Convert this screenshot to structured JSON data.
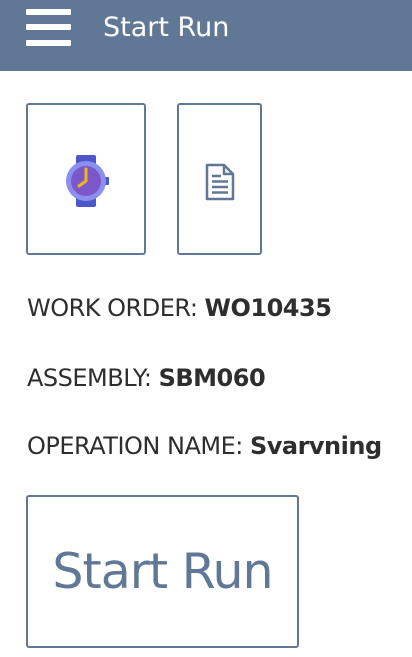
{
  "header": {
    "title": "Start Run",
    "menu_icon": "hamburger-menu-icon"
  },
  "tiles": [
    {
      "icon": "watch-icon"
    },
    {
      "icon": "document-icon"
    }
  ],
  "info": {
    "work_order_label": "WORK ORDER:",
    "work_order_value": "WO10435",
    "assembly_label": "ASSEMBLY:",
    "assembly_value": "SBM060",
    "operation_label": "OPERATION NAME:",
    "operation_value": "Svarvning"
  },
  "actions": {
    "start_run_label": "Start Run"
  },
  "colors": {
    "primary": "#607796",
    "watch_band": "#5b5fd6",
    "watch_face": "#7e62c8",
    "watch_hands": "#f2b51a"
  }
}
